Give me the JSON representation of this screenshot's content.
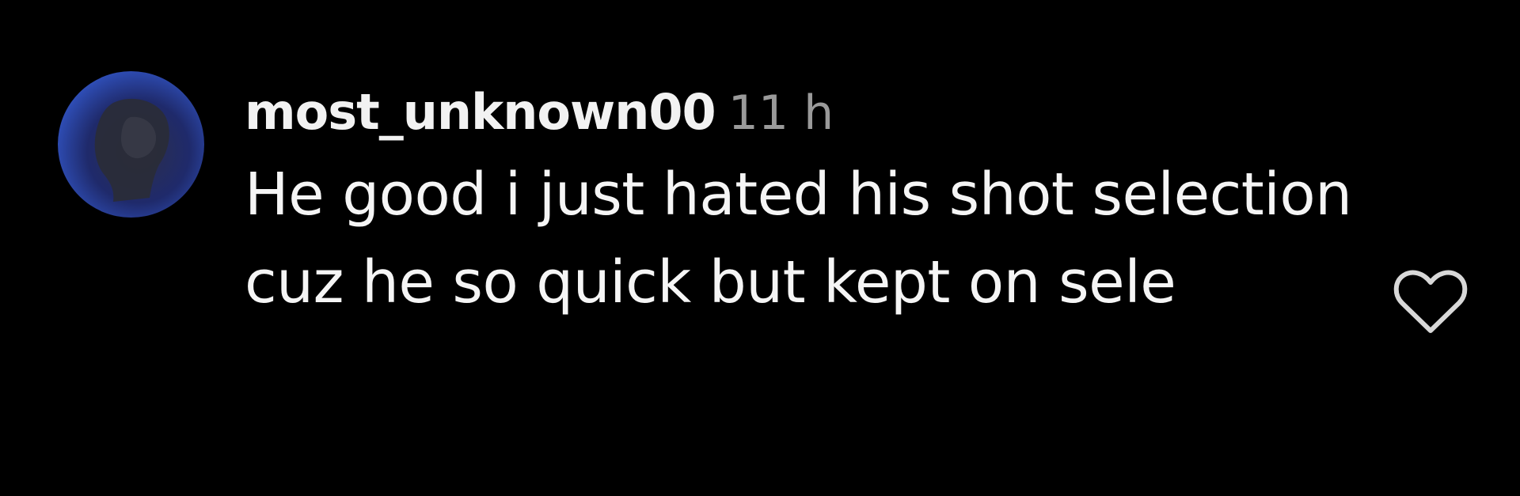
{
  "comment": {
    "username": "most_unknown00",
    "time": "11 h",
    "text": "He good i just hated his shot selection cuz he so quick but kept on sele",
    "avatar_icon": "profile-avatar",
    "like_icon": "heart-outline-icon"
  },
  "colors": {
    "background": "#000000",
    "text": "#f5f5f5",
    "muted": "#9a9a9a",
    "avatar_accent": "#3256c8"
  }
}
